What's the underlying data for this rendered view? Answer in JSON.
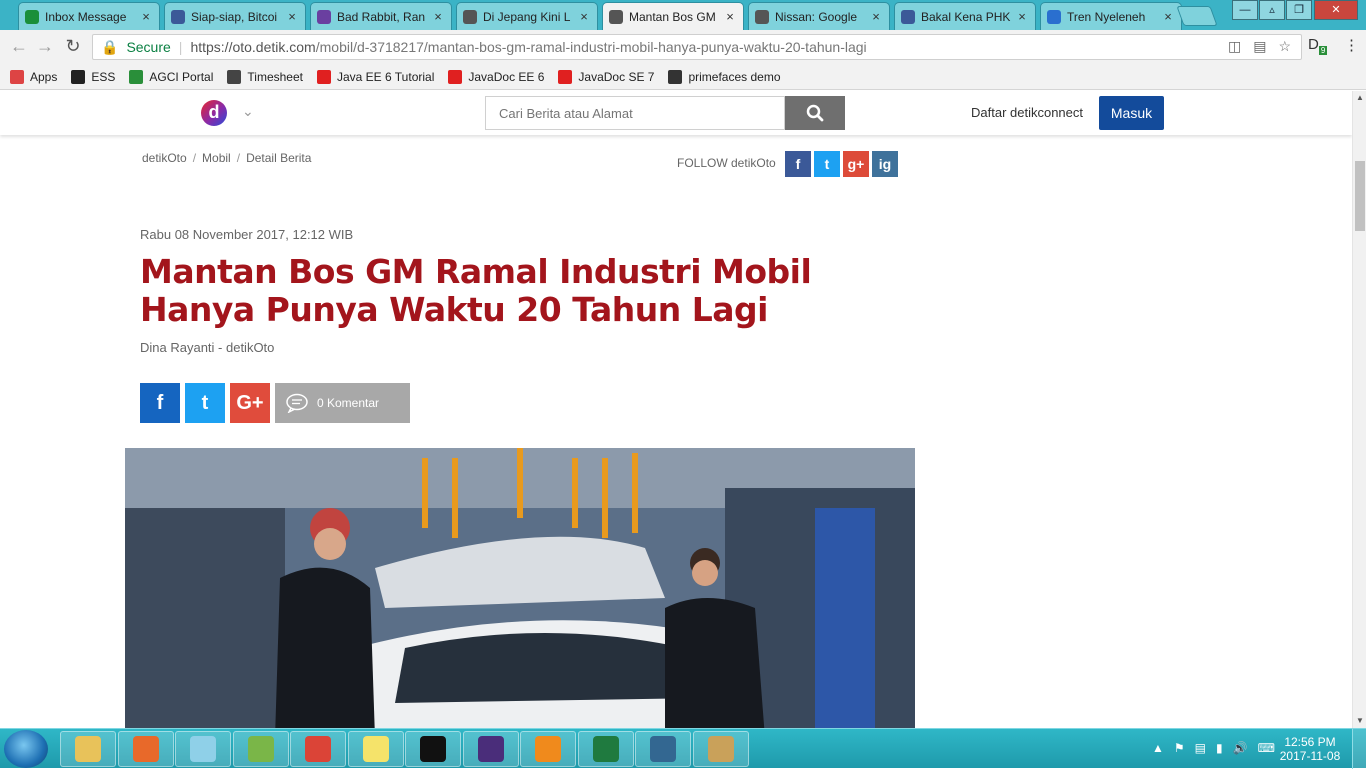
{
  "browser": {
    "tabs": [
      {
        "title": "Inbox Message",
        "icon": "mail-icon",
        "color": "#1a8f3a"
      },
      {
        "title": "Siap-siap, Bitcoi",
        "icon": "facebook-icon",
        "color": "#3b5998"
      },
      {
        "title": "Bad Rabbit, Ran",
        "icon": "info-icon",
        "color": "#6a3fa0"
      },
      {
        "title": "Di Jepang Kini L",
        "icon": "glasses-icon",
        "color": "#555555"
      },
      {
        "title": "Mantan Bos GM",
        "icon": "glasses-icon",
        "color": "#555555"
      },
      {
        "title": "Nissan: Google",
        "icon": "glasses-icon",
        "color": "#555555"
      },
      {
        "title": "Bakal Kena PHK",
        "icon": "facebook-icon",
        "color": "#3b5998"
      },
      {
        "title": "Tren Nyeleneh",
        "icon": "walk-icon",
        "color": "#2a6fcf"
      }
    ],
    "active_tab": 4,
    "secure_label": "Secure",
    "url_host": "https://oto.detik.com",
    "url_path": "/mobil/d-3718217/mantan-bos-gm-ramal-industri-mobil-hanya-punya-waktu-20-tahun-lagi",
    "extension_badge": "9",
    "bookmarks": [
      {
        "label": "Apps",
        "icon": "apps-grid-icon",
        "color": "#d44"
      },
      {
        "label": "ESS",
        "icon": "ess-icon",
        "color": "#222"
      },
      {
        "label": "AGCI Portal",
        "icon": "agci-icon",
        "color": "#2a8f3a"
      },
      {
        "label": "Timesheet",
        "icon": "timesheet-icon",
        "color": "#444"
      },
      {
        "label": "Java EE 6 Tutorial",
        "icon": "oracle-icon",
        "color": "#e02020"
      },
      {
        "label": "JavaDoc EE 6",
        "icon": "oracle-icon",
        "color": "#e02020"
      },
      {
        "label": "JavaDoc SE 7",
        "icon": "oracle-icon",
        "color": "#e02020"
      },
      {
        "label": "primefaces demo",
        "icon": "primefaces-icon",
        "color": "#333"
      }
    ]
  },
  "site": {
    "logo_letter": "d",
    "search_placeholder": "Cari Berita atau Alamat",
    "daftar_label": "Daftar detikconnect",
    "masuk_label": "Masuk",
    "breadcrumbs": [
      "detikOto",
      "Mobil",
      "Detail Berita"
    ],
    "follow_label": "FOLLOW detikOto",
    "follow_icons": [
      {
        "name": "facebook",
        "glyph": "f",
        "color": "#3b5998"
      },
      {
        "name": "twitter",
        "glyph": "t",
        "color": "#1da1f2"
      },
      {
        "name": "googleplus",
        "glyph": "g+",
        "color": "#dd4b39"
      },
      {
        "name": "instagram",
        "glyph": "ig",
        "color": "#3f729b"
      }
    ]
  },
  "article": {
    "date": "Rabu 08 November 2017, 12:12 WIB",
    "title": "Mantan Bos GM Ramal Industri Mobil Hanya Punya Waktu 20 Tahun Lagi",
    "author": "Dina Rayanti - detikOto",
    "share_buttons": [
      {
        "name": "facebook",
        "glyph": "f",
        "color": "#1565c0"
      },
      {
        "name": "twitter",
        "glyph": "t",
        "color": "#1da1f2"
      },
      {
        "name": "googleplus",
        "glyph": "G+",
        "color": "#e04c3c"
      }
    ],
    "comment_label": "0 Komentar",
    "photo_alt": "Factory workers assembling a car roof"
  },
  "taskbar": {
    "apps": [
      {
        "name": "file-explorer",
        "color": "#e8c25a"
      },
      {
        "name": "firefox",
        "color": "#e8692a"
      },
      {
        "name": "notes",
        "color": "#8fd0e8"
      },
      {
        "name": "notepad-plus",
        "color": "#7ab648"
      },
      {
        "name": "chrome",
        "color": "#db4437"
      },
      {
        "name": "sticky-notes",
        "color": "#f5e36a"
      },
      {
        "name": "command-prompt",
        "color": "#111111"
      },
      {
        "name": "java-ee-ide",
        "color": "#4a2d7a"
      },
      {
        "name": "vlc",
        "color": "#f08a1c"
      },
      {
        "name": "excel",
        "color": "#1f7a3f"
      },
      {
        "name": "postgres",
        "color": "#336791"
      },
      {
        "name": "paint",
        "color": "#c9a15a"
      }
    ],
    "time": "12:56 PM",
    "date": "2017-11-08"
  }
}
